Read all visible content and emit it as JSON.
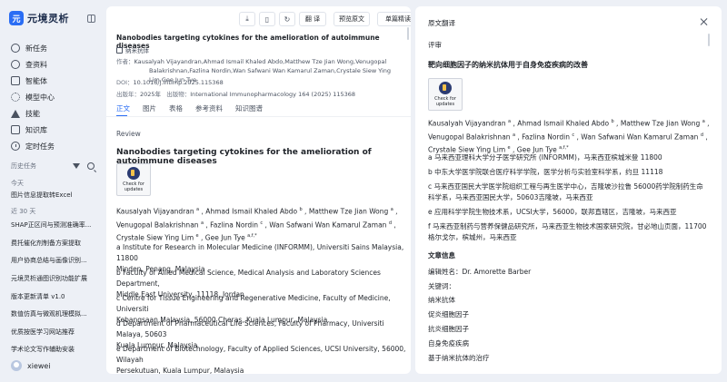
{
  "app": {
    "logo_mark": "元",
    "name": "元境灵析"
  },
  "nav": [
    {
      "label": "新任务",
      "icon": "plus-circle-icon"
    },
    {
      "label": "查资料",
      "icon": "search-icon"
    },
    {
      "label": "智能体",
      "icon": "agent-icon"
    },
    {
      "label": "模型中心",
      "icon": "model-icon"
    },
    {
      "label": "技能",
      "icon": "skill-icon"
    },
    {
      "label": "知识库",
      "icon": "knowledge-icon"
    },
    {
      "label": "定时任务",
      "icon": "clock-icon"
    }
  ],
  "history": {
    "title": "历史任务",
    "groups": [
      {
        "label": "今天"
      },
      {
        "label": "近 30 天"
      }
    ],
    "today_items": [
      "图片信息提取转Excel"
    ],
    "month_items": [
      "SHAP正区间与预测准确率...",
      "费托催化剂制备方案提取",
      "用户协商总结与画像识别...",
      "元境灵析通图识别功能扩展",
      "版本更新清单 v1.0",
      "数值仿真与微观机理模拟...",
      "优质按医学习网站推荐",
      "学术论文写作辅助安装"
    ]
  },
  "user": {
    "name": "xiewei"
  },
  "toolbar": {
    "translate": "翻 译",
    "preview_original": "预览原文",
    "single_read": "单篇精读"
  },
  "paper": {
    "title": "Nanobodies targeting cytokines for the amelioration of autoimmune diseases",
    "journal": "纳米抗体",
    "authors_label": "作者：",
    "authors_line1": "Kausalyah Vijayandran,Ahmad Ismail Khaled Abdo,Matthew Tze Jian Wong,Venugopal",
    "authors_line2": "Balakrishnan,Fazlina Nordin,Wan Safwani Wan Kamarul Zaman,Crystale Siew Ying Lim,Gee Jun Tye",
    "doi_label": "DOI：",
    "doi": "10.1016/j.intimp.2025.115368",
    "year_label": "出版年：",
    "year": "2025年",
    "publisher_label": "出版物：",
    "publisher": "International Immunopharmacology 164 (2025) 115368"
  },
  "tabs": [
    "正文",
    "图片",
    "表格",
    "参考资料",
    "知识图谱"
  ],
  "body": {
    "section": "Review",
    "article_title": "Nanobodies targeting cytokines for the amelioration of autoimmune diseases",
    "badge_line1": "Check for",
    "badge_line2": "updates",
    "authors": [
      "Kausalyah Vijayandran",
      "Ahmad Ismail Khaled Abdo",
      "Matthew Tze Jian Wong",
      "Venugopal Balakrishnan",
      "Fazlina Nordin",
      "Wan Safwani Wan Kamarul Zaman",
      "Crystale Siew Ying Lim",
      "Gee Jun Tye"
    ],
    "sup": {
      "a": "a",
      "b": "b",
      "c": "c",
      "d": "d",
      "e": "e",
      "f": "f",
      "aft": "a,f,*"
    },
    "affiliations": [
      [
        "a Institute for Research in Molecular Medicine (INFORMM), Universiti Sains Malaysia, 11800",
        "Minden, Penang, Malaysia"
      ],
      [
        "b Faculty of Allied Medical Science, Medical Analysis and Laboratory Sciences Department,",
        "Middle East University, 11118, Jordan"
      ],
      [
        "c Centre for Tissue Engineering and Regenerative Medicine, Faculty of Medicine, Universiti",
        "Kebangsaan Malaysia, 56000 Cheras, Kuala Lumpur, Malaysia"
      ],
      [
        "d Department of Pharmaceutical Life Sciences, Faculty of Pharmacy, Universiti Malaya, 50603",
        "Kuala Lumpur, Malaysia"
      ],
      [
        "e Department of Biotechnology, Faculty of Applied Sciences, UCSI University, 56000, Wilayah",
        "Persekutuan, Kuala Lumpur, Malaysia"
      ]
    ]
  },
  "translation": {
    "header": "原文翻译",
    "section": "评审",
    "title": "靶向细胞因子的纳米抗体用于自身免疫疾病的改善",
    "badge_line1": "Check for",
    "badge_line2": "updates",
    "affiliations": [
      [
        "a 马来西亚理科大学分子医学研究所 (INFORMM)，马来西亚槟城米登 11800"
      ],
      [
        "b 中东大学医学院联合医疗科学学院，医学分析与实验室科学系，约旦 11118"
      ],
      [
        "c 马来西亚国民大学医学院组织工程与再生医学中心，吉隆坡沙拉鲁 56000药学院制药生命",
        "科学系，马来西亚国民大学，50603吉隆坡，马来西亚"
      ],
      [
        "e 应用科学学院生物技术系，UCSI大学，56000，联邦直辖区，吉隆坡，马来西亚"
      ],
      [
        "f 马来西亚制药与营养保健品研究所，马来西亚生物技术国家研究院，甘必地山页面，11700",
        "格尔戈尔，槟城州，马来西亚"
      ]
    ],
    "article_info": "文章信息",
    "editor": "编辑姓名：Dr. Amorette Barber",
    "keywords_label": "关键词：",
    "keywords": [
      "纳米抗体",
      "促炎细胞因子",
      "抗炎细胞因子",
      "自身免疫疾病",
      "基于纳米抗体的治疗"
    ]
  }
}
